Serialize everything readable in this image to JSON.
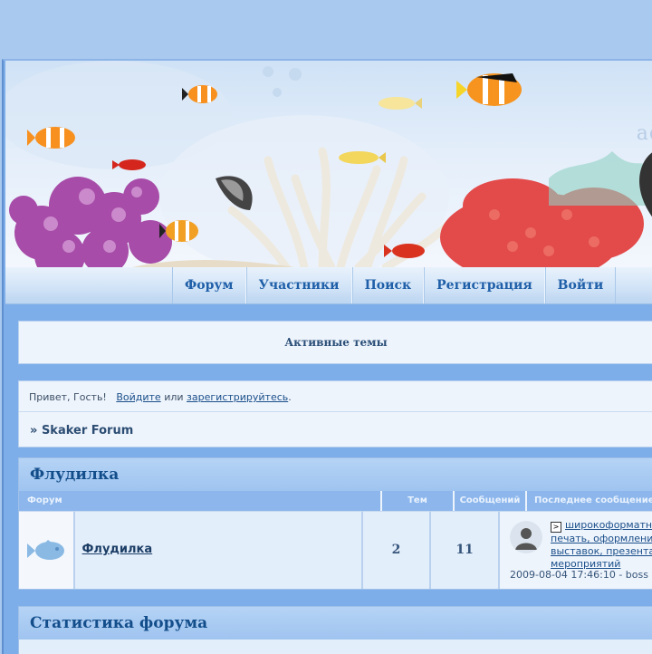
{
  "header": {
    "brand_fragment": "aq"
  },
  "nav": {
    "items": [
      {
        "label": "Форум",
        "name": "nav-forum"
      },
      {
        "label": "Участники",
        "name": "nav-members"
      },
      {
        "label": "Поиск",
        "name": "nav-search"
      },
      {
        "label": "Регистрация",
        "name": "nav-register"
      },
      {
        "label": "Войти",
        "name": "nav-login"
      }
    ]
  },
  "active_topics": {
    "label": "Активные темы"
  },
  "welcome": {
    "greeting": "Привет, Гость!",
    "login_link": "Войдите",
    "or_text": "или",
    "register_link": "зарегистрируйтесь",
    "period": ".",
    "breadcrumb_prefix": "»",
    "breadcrumb_link": "Skaker Forum"
  },
  "categories": [
    {
      "title": "Флудилка",
      "columns": {
        "forum": "Форум",
        "topics": "Тем",
        "posts": "Сообщений",
        "last": "Последнее сообщение"
      },
      "rows": [
        {
          "name": "Флудилка",
          "topics": "2",
          "posts": "11",
          "last_post_title": "широкоформатная печать, оформление выставок, презентаций и мероприятий",
          "last_post_date": "2009-08-04 17:46:10 - ",
          "last_post_author": "boss"
        }
      ]
    },
    {
      "title": "Статистика форума"
    }
  ],
  "colors": {
    "accent": "#134e8b",
    "panel": "#eef4fc",
    "header_blue": "#8cb6ec"
  }
}
